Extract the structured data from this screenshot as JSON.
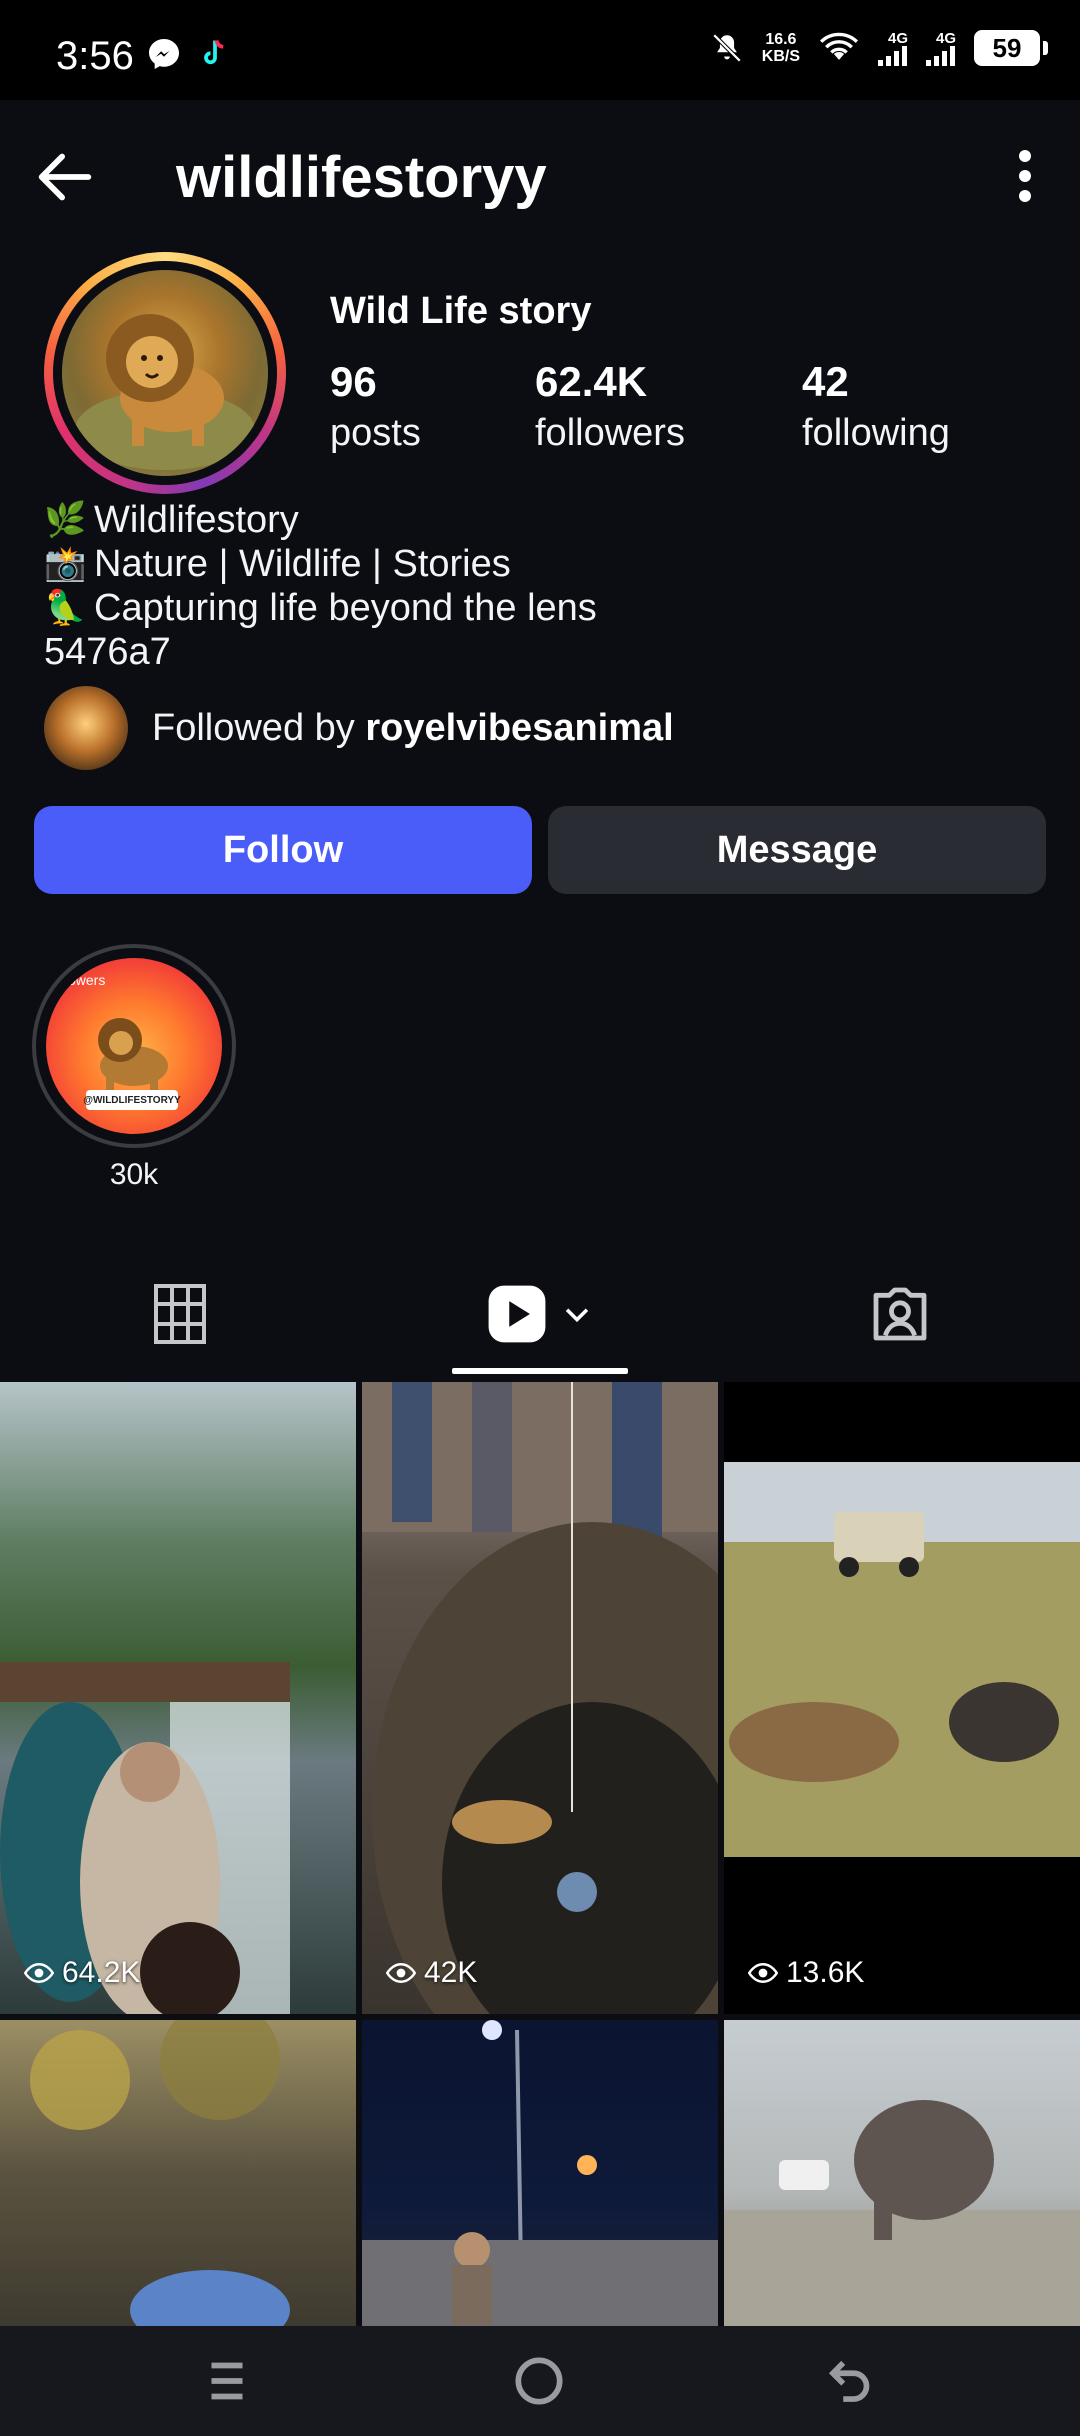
{
  "status_bar": {
    "time": "3:56",
    "net_speed_value": "16.6",
    "net_speed_unit": "KB/S",
    "net_type_1": "4G",
    "net_type_2": "4G",
    "battery": "59",
    "icons": [
      "messenger-icon",
      "tiktok-icon",
      "mute-icon",
      "wifi-icon",
      "signal-icon",
      "battery-icon"
    ]
  },
  "header": {
    "username": "wildlifestoryy",
    "back_icon": "arrow-left-icon",
    "more_icon": "more-vertical-icon"
  },
  "profile": {
    "display_name": "Wild Life story",
    "stats": [
      {
        "value": "96",
        "label": "posts"
      },
      {
        "value": "62.4K",
        "label": "followers"
      },
      {
        "value": "42",
        "label": "following"
      }
    ],
    "bio": [
      {
        "emoji": "🌿",
        "text": "Wildlifestory"
      },
      {
        "emoji": "📸",
        "text": "Nature | Wildlife | Stories"
      },
      {
        "emoji": "🦜",
        "text": "Capturing life beyond the lens"
      },
      {
        "emoji": "",
        "text": "5476a7"
      }
    ],
    "followed_by_prefix": "Followed by ",
    "followed_by_user": "royelvibesanimal"
  },
  "actions": {
    "follow": "Follow",
    "message": "Message"
  },
  "highlights": [
    {
      "label": "30k",
      "cover_text_top": "owers",
      "cover_tag": "@WILDLIFESTORYY"
    }
  ],
  "tabs": [
    "grid-icon",
    "reels-icon",
    "tagged-icon"
  ],
  "grid": [
    {
      "views": "64.2K"
    },
    {
      "views": "42K"
    },
    {
      "views": "13.6K"
    },
    {
      "views": ""
    },
    {
      "views": ""
    },
    {
      "views": ""
    }
  ],
  "nav": [
    "recents-icon",
    "home-icon",
    "back-icon"
  ],
  "colors": {
    "background": "#0b0d13",
    "follow_button": "#4a5df9",
    "message_button": "#2a2c33",
    "navbar": "#17181d"
  }
}
